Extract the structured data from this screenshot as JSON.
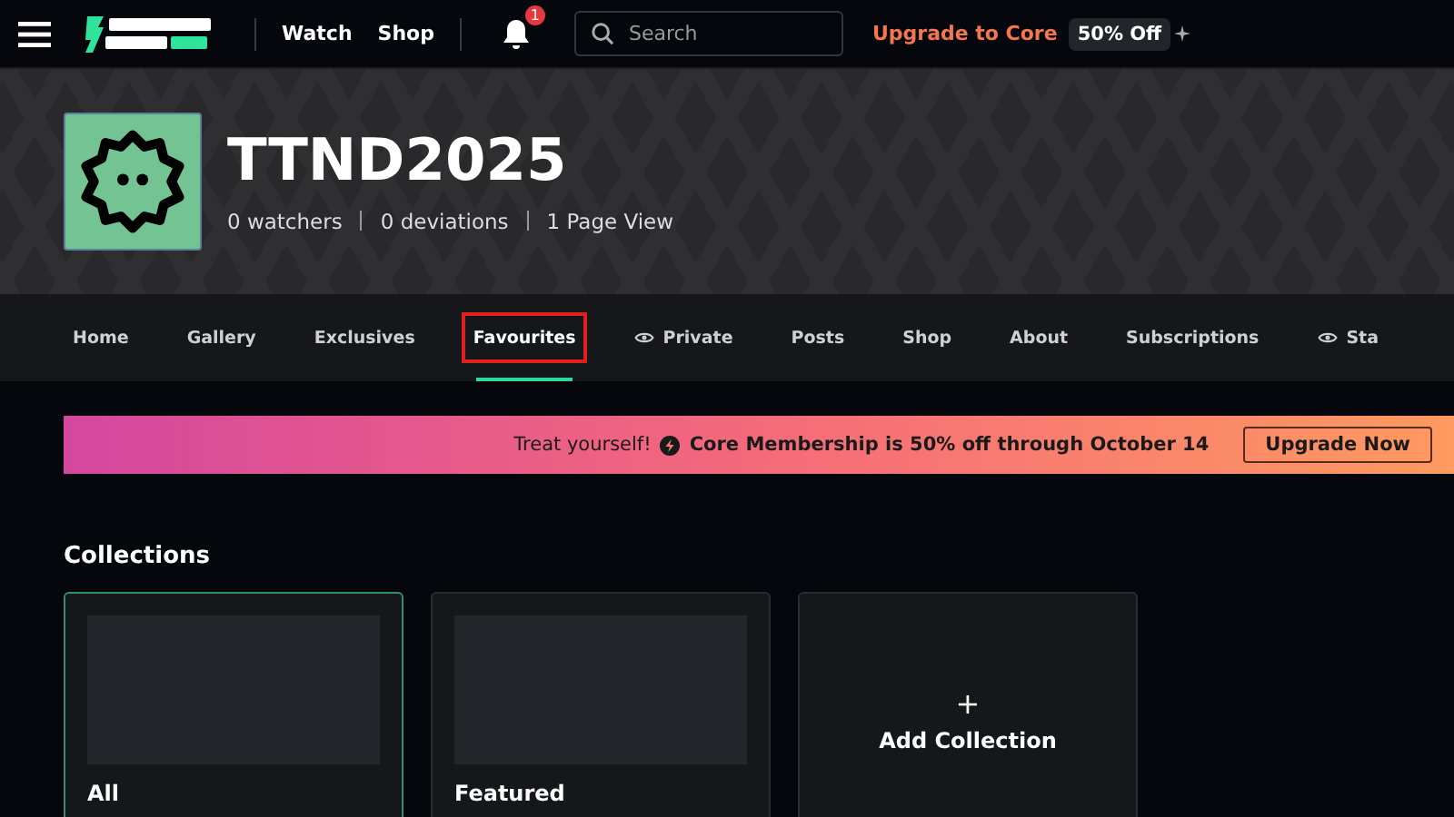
{
  "header": {
    "nav_links": [
      "Watch",
      "Shop"
    ],
    "notification_count": "1",
    "search": {
      "placeholder": "Search"
    },
    "upgrade_link": "Upgrade to Core",
    "discount_badge": "50% Off"
  },
  "profile": {
    "username": "TTND2025",
    "stats": [
      "0 watchers",
      "0 deviations",
      "1 Page View"
    ]
  },
  "tabs": [
    {
      "label": "Home",
      "selected": false,
      "private": false,
      "highlighted": false
    },
    {
      "label": "Gallery",
      "selected": false,
      "private": false,
      "highlighted": false
    },
    {
      "label": "Exclusives",
      "selected": false,
      "private": false,
      "highlighted": false
    },
    {
      "label": "Favourites",
      "selected": true,
      "private": false,
      "highlighted": true
    },
    {
      "label": "Private",
      "selected": false,
      "private": true,
      "highlighted": false
    },
    {
      "label": "Posts",
      "selected": false,
      "private": false,
      "highlighted": false
    },
    {
      "label": "Shop",
      "selected": false,
      "private": false,
      "highlighted": false
    },
    {
      "label": "About",
      "selected": false,
      "private": false,
      "highlighted": false
    },
    {
      "label": "Subscriptions",
      "selected": false,
      "private": false,
      "highlighted": false
    },
    {
      "label": "Sta",
      "selected": false,
      "private": true,
      "highlighted": false
    }
  ],
  "promo": {
    "lead": "Treat yourself!",
    "message": "Core Membership is 50% off through October 14",
    "button": "Upgrade Now"
  },
  "collections": {
    "heading": "Collections",
    "items": [
      {
        "kind": "collection",
        "title": "All",
        "selected": true
      },
      {
        "kind": "collection",
        "title": "Featured",
        "selected": false
      },
      {
        "kind": "add",
        "title": "Add Collection",
        "symbol": "+",
        "selected": false
      }
    ]
  }
}
